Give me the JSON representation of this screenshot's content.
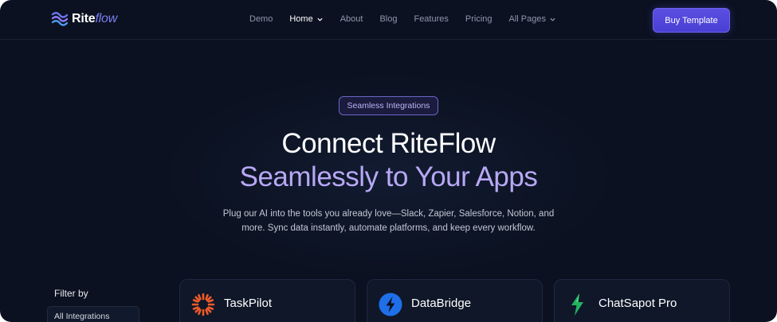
{
  "nav": {
    "brand_main": "Rite",
    "brand_accent": "flow",
    "items": [
      {
        "label": "Demo",
        "active": false,
        "dropdown": false
      },
      {
        "label": "Home",
        "active": true,
        "dropdown": true
      },
      {
        "label": "About",
        "active": false,
        "dropdown": false
      },
      {
        "label": "Blog",
        "active": false,
        "dropdown": false
      },
      {
        "label": "Features",
        "active": false,
        "dropdown": false
      },
      {
        "label": "Pricing",
        "active": false,
        "dropdown": false
      },
      {
        "label": "All Pages",
        "active": false,
        "dropdown": true
      }
    ],
    "cta_label": "Buy Template"
  },
  "hero": {
    "badge": "Seamless Integrations",
    "title_line1": "Connect RiteFlow",
    "title_line2": "Seamlessly to Your Apps",
    "subtitle_line1": "Plug our AI into the tools you already love—Slack, Zapier, Salesforce, Notion, and",
    "subtitle_line2": "more. Sync data instantly, automate platforms, and keep every workflow."
  },
  "filter": {
    "title": "Filter by",
    "items": [
      "All Integrations"
    ]
  },
  "integrations": [
    {
      "name": "TaskPilot",
      "icon": "sunburst-icon",
      "color": "#f05a28"
    },
    {
      "name": "DataBridge",
      "icon": "lightning-icon",
      "color": "#1f6fe8"
    },
    {
      "name": "ChatSapot Pro",
      "icon": "bolt-icon",
      "color": "#22b35e"
    }
  ],
  "colors": {
    "background": "#0b1120",
    "accent": "#5a4fe0",
    "title_gradient": "#b7a8f4"
  }
}
